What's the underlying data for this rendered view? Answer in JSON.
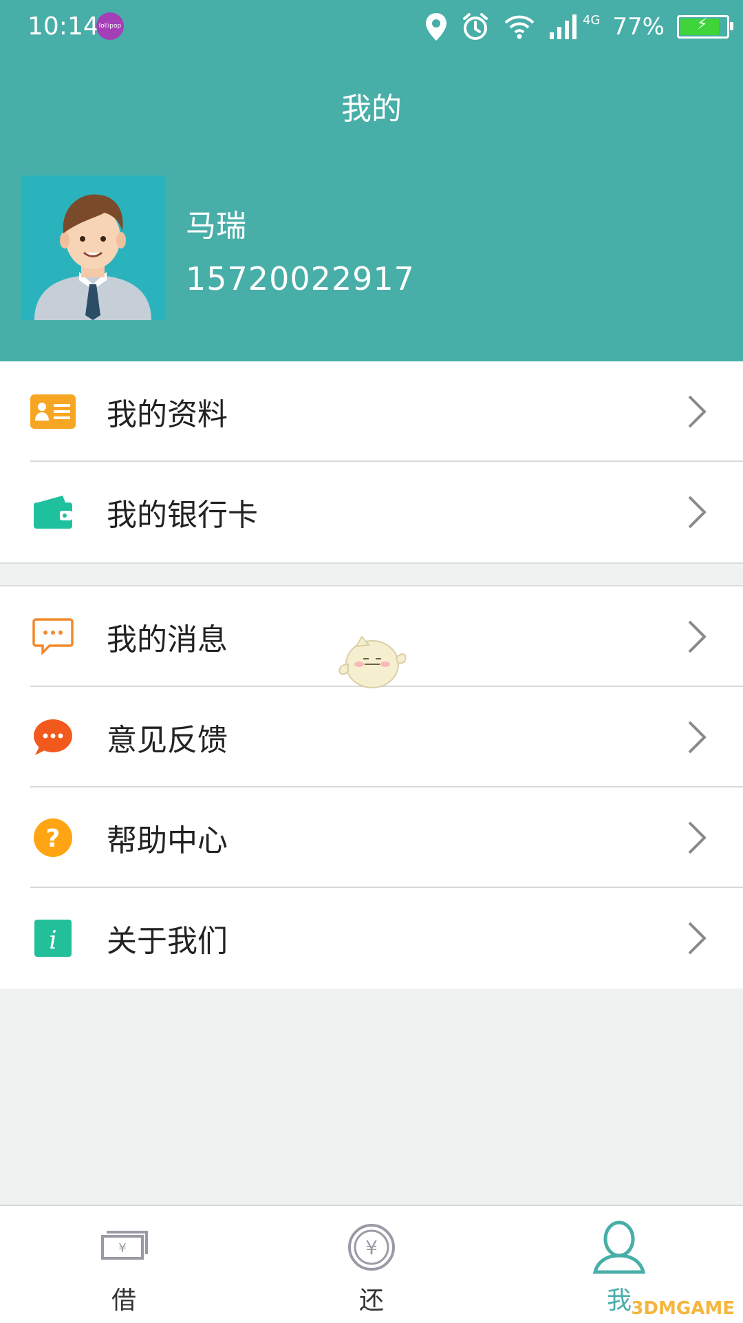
{
  "status": {
    "time": "10:14",
    "badge": "lollipop",
    "network": "4G",
    "battery": "77%"
  },
  "header": {
    "title": "我的"
  },
  "user": {
    "name": "马瑞",
    "phone": "15720022917"
  },
  "menu_group1": [
    {
      "label": "我的资料",
      "icon": "profile-card-icon"
    },
    {
      "label": "我的银行卡",
      "icon": "wallet-icon"
    }
  ],
  "menu_group2": [
    {
      "label": "我的消息",
      "icon": "message-icon"
    },
    {
      "label": "意见反馈",
      "icon": "feedback-icon"
    },
    {
      "label": "帮助中心",
      "icon": "help-icon"
    },
    {
      "label": "关于我们",
      "icon": "info-icon"
    }
  ],
  "tabs": [
    {
      "label": "借",
      "icon": "cash-icon"
    },
    {
      "label": "还",
      "icon": "yen-coin-icon"
    },
    {
      "label": "我",
      "icon": "user-icon",
      "active": true
    }
  ],
  "watermark": "3DMGAME",
  "colors": {
    "primary": "#48aea8",
    "background": "#eff2f1",
    "profile_icon": "#f7a623",
    "wallet_icon": "#1fc09d",
    "message_icon": "#f28a2c",
    "feedback_icon": "#f25a1d",
    "help_icon": "#ffa412",
    "info_icon": "#23bf9a"
  }
}
